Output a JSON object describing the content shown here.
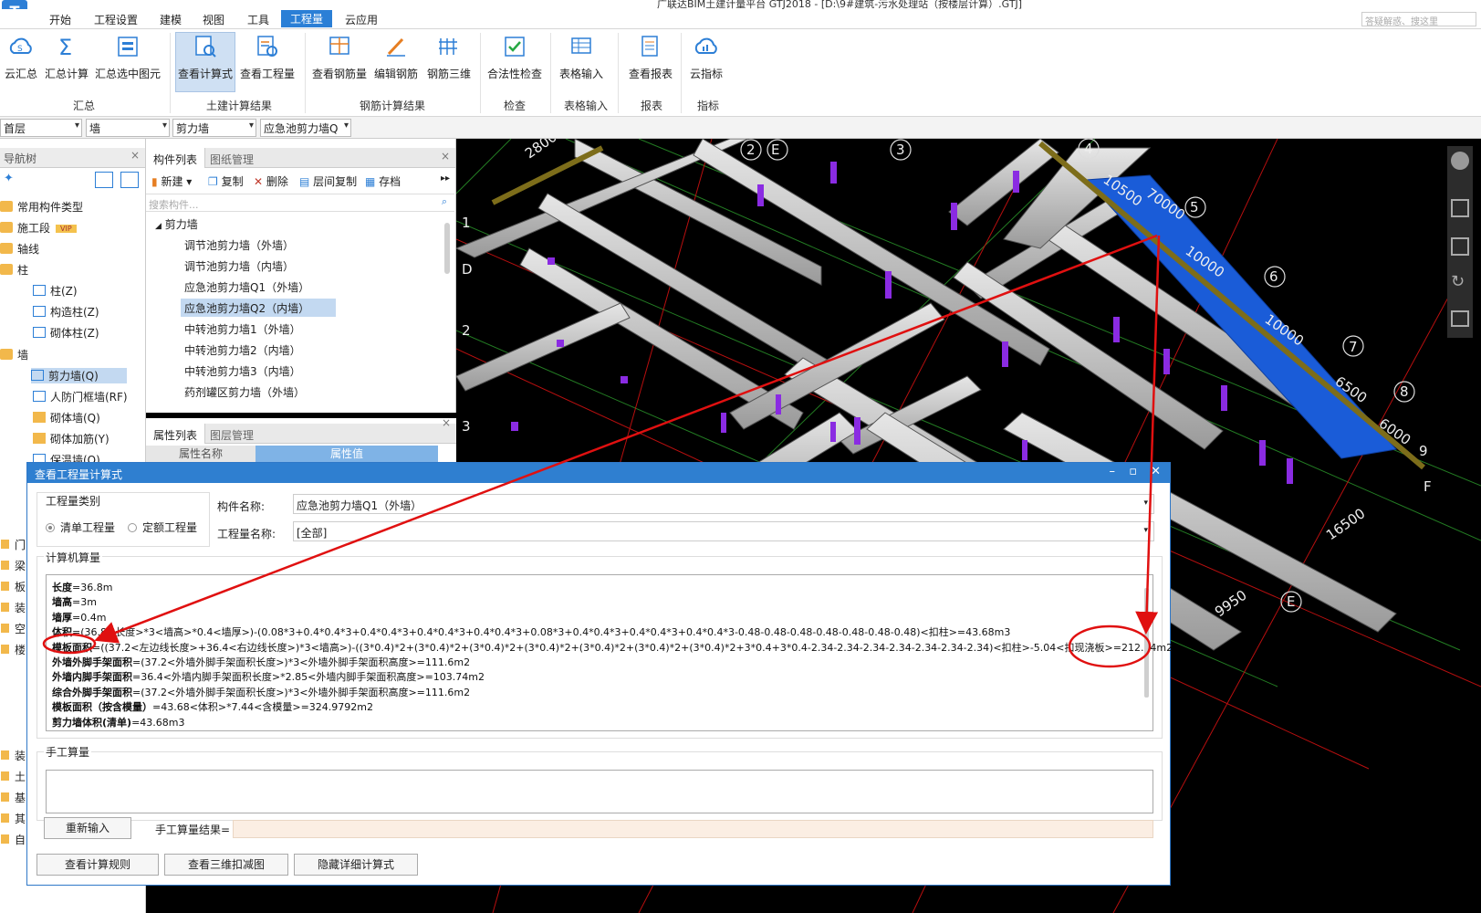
{
  "window": {
    "title": "广联达BIM土建计量平台 GTJ2018 - [D:\\9#建筑-污水处理站（按楼层计算）.GTJ]",
    "help_search_placeholder": "答疑解惑、搜这里",
    "logo": "T"
  },
  "menu": [
    "开始",
    "工程设置",
    "建模",
    "视图",
    "工具",
    "工程量",
    "云应用"
  ],
  "menu_active": "工程量",
  "ribbon": {
    "buttons": [
      {
        "label": "云汇总",
        "icon": "cloud-sum-icon"
      },
      {
        "label": "汇总计算",
        "icon": "sigma-icon"
      },
      {
        "label": "汇总选中图元",
        "icon": "select-sum-icon"
      },
      {
        "label": "查看计算式",
        "icon": "view-formula-icon"
      },
      {
        "label": "查看工程量",
        "icon": "view-quantity-icon"
      },
      {
        "label": "查看钢筋量",
        "icon": "view-rebar-icon"
      },
      {
        "label": "编辑钢筋",
        "icon": "edit-rebar-icon"
      },
      {
        "label": "钢筋三维",
        "icon": "rebar-3d-icon"
      },
      {
        "label": "合法性检查",
        "icon": "check-icon"
      },
      {
        "label": "表格输入",
        "icon": "table-input-icon"
      },
      {
        "label": "查看报表",
        "icon": "report-icon"
      },
      {
        "label": "云指标",
        "icon": "cloud-index-icon"
      }
    ],
    "groups": [
      "汇总",
      "土建计算结果",
      "钢筋计算结果",
      "检查",
      "表格输入",
      "报表",
      "指标"
    ]
  },
  "filters": [
    "首层",
    "墙",
    "剪力墙",
    "应急池剪力墙Q"
  ],
  "nav_tree": {
    "title": "导航树",
    "items": [
      {
        "label": "常用构件类型"
      },
      {
        "label": "施工段",
        "badge": "VIP"
      },
      {
        "label": "轴线"
      },
      {
        "label": "柱"
      },
      {
        "label": "柱(Z)"
      },
      {
        "label": "构造柱(Z)"
      },
      {
        "label": "砌体柱(Z)"
      },
      {
        "label": "墙"
      },
      {
        "label": "剪力墙(Q)"
      },
      {
        "label": "人防门框墙(RF)"
      },
      {
        "label": "砌体墙(Q)"
      },
      {
        "label": "砌体加筋(Y)"
      },
      {
        "label": "保温墙(Q)"
      }
    ],
    "lower": [
      "门",
      "梁",
      "板",
      "装",
      "空",
      "楼",
      "装",
      "土",
      "基",
      "其",
      "自"
    ]
  },
  "component_list": {
    "tabs": [
      "构件列表",
      "图纸管理"
    ],
    "tools": [
      "新建",
      "复制",
      "删除",
      "层间复制",
      "存档"
    ],
    "search_placeholder": "搜索构件...",
    "group": "剪力墙",
    "items": [
      "调节池剪力墙（外墙）",
      "调节池剪力墙（内墙）",
      "应急池剪力墙Q1（外墙）",
      "应急池剪力墙Q2（内墙）",
      "中转池剪力墙1（外墙）",
      "中转池剪力墙2（内墙）",
      "中转池剪力墙3（内墙）",
      "药剂罐区剪力墙（外墙）"
    ],
    "selected_index": 3
  },
  "properties": {
    "tabs": [
      "属性列表",
      "图层管理"
    ],
    "columns": [
      "属性名称",
      "属性值"
    ]
  },
  "viewport": {
    "axis_labels": [
      "1",
      "D",
      "2",
      "3",
      "2",
      "E",
      "3",
      "4",
      "5",
      "6",
      "7",
      "8",
      "9",
      "F",
      "E"
    ],
    "dims": [
      "2800",
      "10500",
      "70000",
      "10000",
      "10000",
      "6500",
      "6000",
      "16500",
      "9950"
    ]
  },
  "dialog": {
    "title": "查看工程量计算式",
    "category_legend": "工程量类别",
    "radio_list": "清单工程量",
    "radio_quota": "定额工程量",
    "comp_name_label": "构件名称:",
    "comp_name_value": "应急池剪力墙Q1（外墙）",
    "qty_name_label": "工程量名称:",
    "qty_name_value": "[全部]",
    "machine_legend": "计算机算量",
    "formula_lines": [
      {
        "k": "长度",
        "v": "=36.8m"
      },
      {
        "k": "墙高",
        "v": "=3m"
      },
      {
        "k": "墙厚",
        "v": "=0.4m"
      },
      {
        "k": "体积",
        "v": "=(36.8<长度>*3<墙高>*0.4<墙厚>)-(0.08*3+0.4*0.4*3+0.4*0.4*3+0.4*0.4*3+0.4*0.4*3+0.08*3+0.4*0.4*3+0.4*0.4*3+0.4*0.4*3-0.48-0.48-0.48-0.48-0.48-0.48-0.48)<扣柱>=43.68m3"
      },
      {
        "k": "模板面积",
        "v": "=((37.2<左边线长度>+36.4<右边线长度>)*3<墙高>)-((3*0.4)*2+(3*0.4)*2+(3*0.4)*2+(3*0.4)*2+(3*0.4)*2+(3*0.4)*2+(3*0.4)*2+3*0.4+3*0.4-2.34-2.34-2.34-2.34-2.34-2.34-2.34)<扣柱>-5.04<扣现浇板>=212.94m2"
      },
      {
        "k": "外墙外脚手架面积",
        "v": "=(37.2<外墙外脚手架面积长度>)*3<外墙外脚手架面积高度>=111.6m2"
      },
      {
        "k": "外墙内脚手架面积",
        "v": "=36.4<外墙内脚手架面积长度>*2.85<外墙内脚手架面积高度>=103.74m2"
      },
      {
        "k": "综合外脚手架面积",
        "v": "=(37.2<外墙外脚手架面积长度>)*3<外墙外脚手架面积高度>=111.6m2"
      },
      {
        "k": "模板面积（按含模量）",
        "v": "=43.68<体积>*7.44<含模量>=324.9792m2"
      },
      {
        "k": "剪力墙体积(清单)",
        "v": "=43.68m3"
      }
    ],
    "manual_legend": "手工算量",
    "reinput_button": "重新输入",
    "manual_result_label": "手工算量结果=",
    "btn_rules": "查看计算规则",
    "btn_3d": "查看三维扣减图",
    "btn_hide": "隐藏详细计算式"
  }
}
